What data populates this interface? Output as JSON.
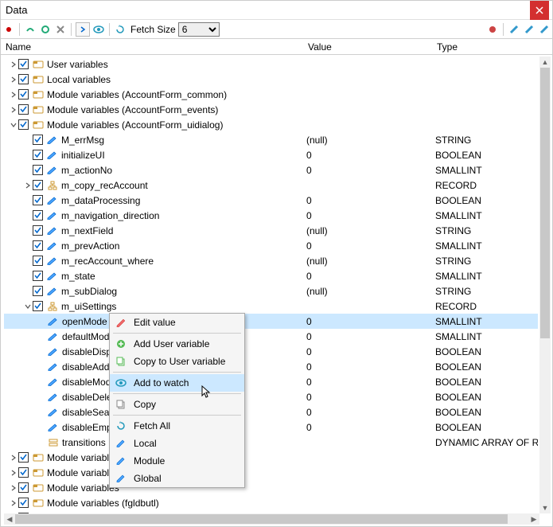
{
  "window": {
    "title": "Data"
  },
  "toolbar": {
    "fetch_label": "Fetch Size",
    "fetch_value": "6"
  },
  "columns": {
    "name": "Name",
    "value": "Value",
    "type": "Type"
  },
  "rows": [
    {
      "indent": 0,
      "twisty": ">",
      "cb": true,
      "icon": "module",
      "name": "User variables",
      "value": "",
      "type": ""
    },
    {
      "indent": 0,
      "twisty": ">",
      "cb": true,
      "icon": "module",
      "name": "Local variables",
      "value": "",
      "type": ""
    },
    {
      "indent": 0,
      "twisty": ">",
      "cb": true,
      "icon": "module",
      "name": "Module variables (AccountForm_common)",
      "value": "",
      "type": ""
    },
    {
      "indent": 0,
      "twisty": ">",
      "cb": true,
      "icon": "module",
      "name": "Module variables (AccountForm_events)",
      "value": "",
      "type": ""
    },
    {
      "indent": 0,
      "twisty": "v",
      "cb": true,
      "icon": "module",
      "name": "Module variables (AccountForm_uidialog)",
      "value": "",
      "type": ""
    },
    {
      "indent": 1,
      "twisty": "",
      "cb": true,
      "icon": "pencil",
      "name": "M_errMsg",
      "value": "(null)",
      "type": "STRING"
    },
    {
      "indent": 1,
      "twisty": "",
      "cb": true,
      "icon": "pencil",
      "name": "initializeUI",
      "value": "0",
      "type": "BOOLEAN"
    },
    {
      "indent": 1,
      "twisty": "",
      "cb": true,
      "icon": "pencil",
      "name": "m_actionNo",
      "value": "0",
      "type": "SMALLINT"
    },
    {
      "indent": 1,
      "twisty": ">",
      "cb": true,
      "icon": "struct",
      "name": "m_copy_recAccount",
      "value": "",
      "type": "RECORD"
    },
    {
      "indent": 1,
      "twisty": "",
      "cb": true,
      "icon": "pencil",
      "name": "m_dataProcessing",
      "value": "0",
      "type": "BOOLEAN"
    },
    {
      "indent": 1,
      "twisty": "",
      "cb": true,
      "icon": "pencil",
      "name": "m_navigation_direction",
      "value": "0",
      "type": "SMALLINT"
    },
    {
      "indent": 1,
      "twisty": "",
      "cb": true,
      "icon": "pencil",
      "name": "m_nextField",
      "value": "(null)",
      "type": "STRING"
    },
    {
      "indent": 1,
      "twisty": "",
      "cb": true,
      "icon": "pencil",
      "name": "m_prevAction",
      "value": "0",
      "type": "SMALLINT"
    },
    {
      "indent": 1,
      "twisty": "",
      "cb": true,
      "icon": "pencil",
      "name": "m_recAccount_where",
      "value": "(null)",
      "type": "STRING"
    },
    {
      "indent": 1,
      "twisty": "",
      "cb": true,
      "icon": "pencil",
      "name": "m_state",
      "value": "0",
      "type": "SMALLINT"
    },
    {
      "indent": 1,
      "twisty": "",
      "cb": true,
      "icon": "pencil",
      "name": "m_subDialog",
      "value": "(null)",
      "type": "STRING"
    },
    {
      "indent": 1,
      "twisty": "v",
      "cb": true,
      "icon": "struct",
      "name": "m_uiSettings",
      "value": "",
      "type": "RECORD"
    },
    {
      "indent": 2,
      "twisty": "",
      "cb": false,
      "icon": "pencil",
      "name": "openMode",
      "value": "0",
      "type": "SMALLINT",
      "selected": true
    },
    {
      "indent": 2,
      "twisty": "",
      "cb": false,
      "icon": "pencil",
      "name": "defaultMode",
      "value": "0",
      "type": "SMALLINT"
    },
    {
      "indent": 2,
      "twisty": "",
      "cb": false,
      "icon": "pencil",
      "name": "disableDisplay",
      "value": "0",
      "type": "BOOLEAN"
    },
    {
      "indent": 2,
      "twisty": "",
      "cb": false,
      "icon": "pencil",
      "name": "disableAdd",
      "value": "0",
      "type": "BOOLEAN"
    },
    {
      "indent": 2,
      "twisty": "",
      "cb": false,
      "icon": "pencil",
      "name": "disableModify",
      "value": "0",
      "type": "BOOLEAN"
    },
    {
      "indent": 2,
      "twisty": "",
      "cb": false,
      "icon": "pencil",
      "name": "disableDelete",
      "value": "0",
      "type": "BOOLEAN"
    },
    {
      "indent": 2,
      "twisty": "",
      "cb": false,
      "icon": "pencil",
      "name": "disableSearch",
      "value": "0",
      "type": "BOOLEAN"
    },
    {
      "indent": 2,
      "twisty": "",
      "cb": false,
      "icon": "pencil",
      "name": "disableEmpty",
      "value": "0",
      "type": "BOOLEAN"
    },
    {
      "indent": 2,
      "twisty": "",
      "cb": false,
      "icon": "arr",
      "name": "transitions",
      "value": "",
      "type": "DYNAMIC ARRAY OF RECO"
    },
    {
      "indent": 0,
      "twisty": ">",
      "cb": true,
      "icon": "module",
      "name": "Module variables",
      "value": "",
      "type": ""
    },
    {
      "indent": 0,
      "twisty": ">",
      "cb": true,
      "icon": "module",
      "name": "Module variables",
      "value": "",
      "type": ""
    },
    {
      "indent": 0,
      "twisty": ">",
      "cb": true,
      "icon": "module",
      "name": "Module variables",
      "value": "",
      "type": ""
    },
    {
      "indent": 0,
      "twisty": ">",
      "cb": true,
      "icon": "module",
      "name": "Module variables (fgldbutl)",
      "value": "",
      "type": ""
    },
    {
      "indent": 0,
      "twisty": ">",
      "cb": true,
      "icon": "module",
      "name": "Module variables (gredesigntime)",
      "value": "",
      "type": ""
    }
  ],
  "context_menu": {
    "items": [
      {
        "icon": "pencil-red",
        "label": "Edit value"
      },
      {
        "sep": true
      },
      {
        "icon": "plus-green",
        "label": "Add User variable"
      },
      {
        "icon": "copy-green",
        "label": "Copy to User variable"
      },
      {
        "sep": true
      },
      {
        "icon": "eye",
        "label": "Add to watch",
        "hover": true
      },
      {
        "sep": true
      },
      {
        "icon": "copy",
        "label": "Copy"
      },
      {
        "sep": true
      },
      {
        "icon": "refresh",
        "label": "Fetch All"
      },
      {
        "icon": "pencil-sm",
        "label": "Local"
      },
      {
        "icon": "pencil-sm",
        "label": "Module"
      },
      {
        "icon": "pencil-sm",
        "label": "Global"
      }
    ]
  }
}
